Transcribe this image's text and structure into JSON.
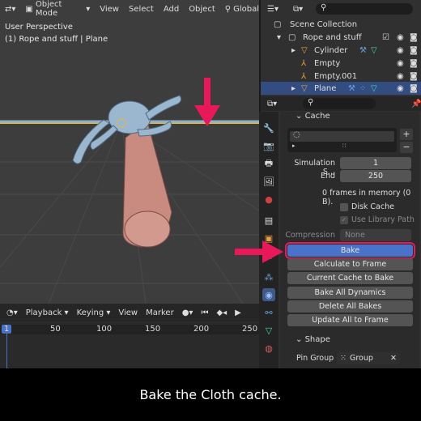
{
  "viewport": {
    "mode": "Object Mode",
    "menu": [
      "View",
      "Select",
      "Add",
      "Object"
    ],
    "orientation": "Global",
    "perspective": "User Perspective",
    "object_info": "(1) Rope and stuff | Plane"
  },
  "outliner": {
    "search_placeholder": "",
    "root": "Scene Collection",
    "collection": "Rope and stuff",
    "items": [
      "Cylinder",
      "Empty",
      "Empty.001",
      "Plane"
    ],
    "selected": "Plane"
  },
  "properties": {
    "cache_label": "Cache",
    "simulation_start_label": "Simulation S...",
    "simulation_start_value": "1",
    "end_label": "End",
    "end_value": "250",
    "memory_info": "0 frames in memory (0 B).",
    "disk_cache_label": "Disk Cache",
    "use_library_path_label": "Use Library Path",
    "compression_label": "Compression",
    "compression_value": "None",
    "buttons": [
      "Bake",
      "Calculate to Frame",
      "Current Cache to Bake",
      "Bake All Dynamics",
      "Delete All Bakes",
      "Update All to Frame"
    ],
    "shape_label": "Shape",
    "pin_group_label": "Pin Group",
    "pin_group_value": "Group"
  },
  "timeline": {
    "menu": [
      "Playback",
      "Keying",
      "View",
      "Marker"
    ],
    "current_frame": "1",
    "ticks": [
      "50",
      "100",
      "150",
      "200",
      "250"
    ]
  },
  "caption": "Bake the Cloth cache.",
  "colors": {
    "accent_pink": "#e8185a",
    "bake_blue": "#4a72c8",
    "selection": "#334d80"
  }
}
